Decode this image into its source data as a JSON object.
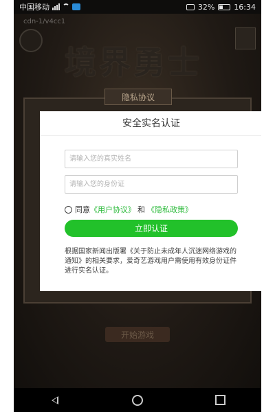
{
  "status_bar": {
    "carrier": "中国移动",
    "battery": "32%",
    "time": "16:34"
  },
  "game": {
    "build_id": "cdn-1/v4cc1",
    "logo_title": "境界勇士",
    "privacy_tab": "隐私协议",
    "start_button": "开始游戏"
  },
  "dialog": {
    "title": "安全实名认证",
    "name_placeholder": "请输入您的真实姓名",
    "id_placeholder": "请输入您的身份证",
    "agree_prefix": "同意",
    "user_agreement": "《用户协议》",
    "and": "和",
    "privacy_policy": "《隐私政策》",
    "submit": "立即认证",
    "notice": "根据国家新闻出版署《关于防止未成年人沉迷网络游戏的通知》的相关要求，爱奇艺游戏用户需使用有效身份证件进行实名认证。"
  },
  "colors": {
    "accent_green": "#22c12a",
    "link_green": "#2dbb3c"
  },
  "icons": {
    "nav_back": "back-triangle-icon",
    "nav_home": "home-circle-icon",
    "nav_recent": "recent-square-icon"
  }
}
